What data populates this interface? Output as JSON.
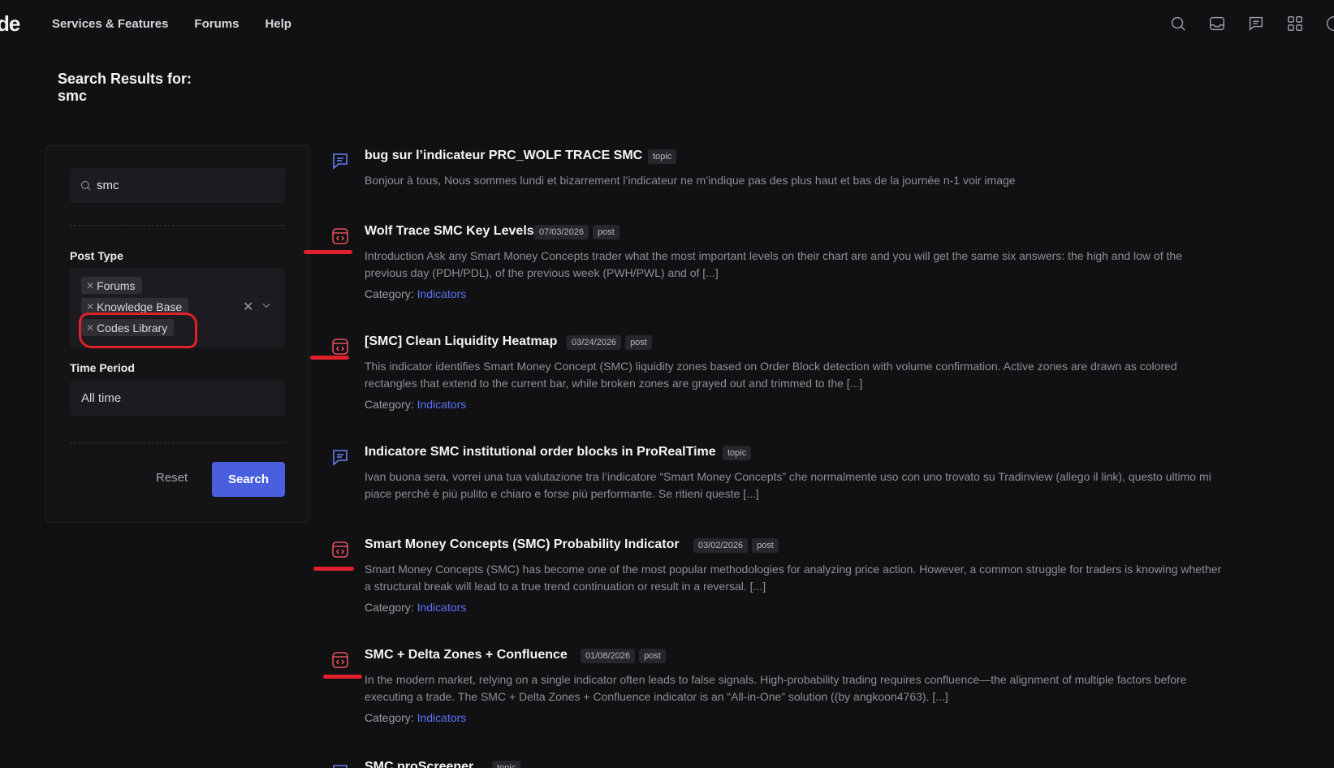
{
  "header": {
    "logo": "de",
    "nav": [
      "Services & Features",
      "Forums",
      "Help"
    ],
    "icons": [
      "search-icon",
      "inbox-icon",
      "chat-icon",
      "apps-grid-icon",
      "account-icon"
    ]
  },
  "page": {
    "title_line1": "Search Results for:",
    "title_line2": "smc"
  },
  "filters": {
    "search_value": "smc",
    "post_type_label": "Post Type",
    "post_types": [
      "Forums",
      "Knowledge Base",
      "Codes Library"
    ],
    "time_period_label": "Time Period",
    "time_period_value": "All time",
    "reset_label": "Reset",
    "search_label": "Search"
  },
  "results": [
    {
      "type": "topic",
      "icon": "forum-topic-icon",
      "title": "bug sur l’indicateur PRC_WOLF TRACE SMC",
      "tags": [
        "topic"
      ],
      "excerpt": "Bonjour à tous, Nous sommes lundi et bizarrement l’indicateur ne m’indique pas des plus haut et bas de la journée n-1 voir image",
      "category_label": "",
      "category": ""
    },
    {
      "type": "post",
      "icon": "code-post-icon",
      "title": "Wolf Trace SMC Key Levels",
      "tags": [
        "07/03/2026",
        "post"
      ],
      "excerpt": "Introduction Ask any Smart Money Concepts trader what the most important levels on their chart are and you will get the same six answers: the high and low of the previous day (PDH/PDL), of the previous week (PWH/PWL) and of [...]",
      "category_label": "Category:",
      "category": "Indicators"
    },
    {
      "type": "post",
      "icon": "code-post-icon",
      "title": "[SMC] Clean Liquidity Heatmap",
      "tags": [
        "03/24/2026",
        "post"
      ],
      "excerpt": "This indicator identifies Smart Money Concept (SMC) liquidity zones based on Order Block detection with volume confirmation. Active zones are drawn as colored rectangles that extend to the current bar, while broken zones are grayed out and trimmed to the [...]",
      "category_label": "Category:",
      "category": "Indicators"
    },
    {
      "type": "topic",
      "icon": "forum-topic-icon",
      "title": "Indicatore SMC institutional order blocks in ProRealTime",
      "tags": [
        "topic"
      ],
      "excerpt": "Ivan buona sera, vorrei una tua valutazione tra l’indicatore “Smart Money Concepts” che normalmente uso con uno trovato su Tradinview (allego il link), questo ultimo mi piace perchè è più pulito e chiaro e forse più performante. Se ritieni queste [...]",
      "category_label": "",
      "category": ""
    },
    {
      "type": "post",
      "icon": "code-post-icon",
      "title": "Smart Money Concepts (SMC) Probability Indicator",
      "tags": [
        "03/02/2026",
        "post"
      ],
      "excerpt": "Smart Money Concepts (SMC) has become one of the most popular methodologies for analyzing price action. However, a common struggle for traders is knowing whether a structural break will lead to a true trend continuation or result in a reversal. [...]",
      "category_label": "Category:",
      "category": "Indicators"
    },
    {
      "type": "post",
      "icon": "code-post-icon",
      "title": "SMC + Delta Zones + Confluence",
      "tags": [
        "01/08/2026",
        "post"
      ],
      "excerpt": "In the modern market, relying on a single indicator often leads to false signals. High-probability trading requires confluence—the alignment of multiple factors before executing a trade. The SMC + Delta Zones + Confluence indicator is an “All-in-One” solution ((by angkoon4763). [...]",
      "category_label": "Category:",
      "category": "Indicators"
    },
    {
      "type": "topic",
      "icon": "forum-topic-icon",
      "title": "SMC proScreener",
      "tags": [
        "topic"
      ],
      "excerpt": "",
      "category_label": "",
      "category": ""
    }
  ],
  "colors": {
    "accent": "#4a5fe0",
    "link": "#5a72f5",
    "annotation": "#e0202a",
    "topic_icon": "#6b7cf2",
    "post_icon": "#e4505a"
  }
}
